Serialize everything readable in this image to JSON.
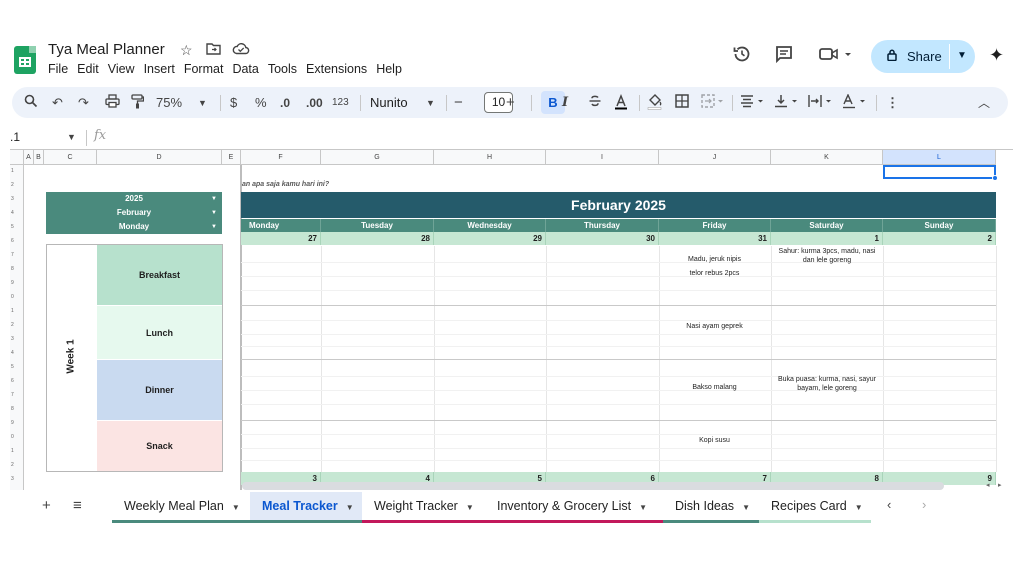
{
  "doc": {
    "title": "Tya Meal Planner",
    "menu": [
      "File",
      "Edit",
      "View",
      "Insert",
      "Format",
      "Data",
      "Tools",
      "Extensions",
      "Help"
    ]
  },
  "share": {
    "label": "Share"
  },
  "toolbar": {
    "zoom": "75%",
    "currency": "$",
    "percent": "%",
    "dec_decrease": ".0",
    "dec_increase": ".00",
    "number_format": "123",
    "font": "Nunito",
    "font_size": "10",
    "minus": "−",
    "plus": "+",
    "bold": "B",
    "italic": "I"
  },
  "formula_bar": {
    "name_box": ".1",
    "fx": "fx"
  },
  "columns": [
    "A",
    "B",
    "C",
    "D",
    "E",
    "F",
    "G",
    "H",
    "I",
    "J",
    "K",
    "L"
  ],
  "selected_column": "L",
  "selectors": [
    "2025",
    "February",
    "Monday"
  ],
  "week_label": "Week 1",
  "meals": [
    "Breakfast",
    "Lunch",
    "Dinner",
    "Snack"
  ],
  "meal_colors": [
    "#b7e1cd",
    "#e6f9ee",
    "#c9daf0",
    "#fbe4e3"
  ],
  "hint": "an apa saja kamu hari ini?",
  "calendar": {
    "month": "February 2025",
    "days": [
      "Monday",
      "Tuesday",
      "Wednesday",
      "Thursday",
      "Friday",
      "Saturday",
      "Sunday"
    ],
    "dates": [
      "27",
      "28",
      "29",
      "30",
      "31",
      "1",
      "2"
    ],
    "next_dates": [
      "3",
      "4",
      "5",
      "6",
      "7",
      "8",
      "9"
    ],
    "friday": {
      "breakfast_1": "Madu, jeruk nipis",
      "breakfast_2": "telor rebus 2pcs",
      "lunch": "Nasi ayam geprek",
      "dinner": "Bakso malang",
      "snack": "Kopi susu"
    },
    "saturday": {
      "breakfast": "Sahur: kurma 3pcs, madu, nasi dan lele goreng",
      "dinner": "Buka puasa: kurma, nasi, sayur bayam, lele goreng"
    }
  },
  "sheet_tabs": [
    {
      "label": "Weekly Meal Plan",
      "color": "#4a8a7d"
    },
    {
      "label": "Meal Tracker",
      "color": "#4a8a7d"
    },
    {
      "label": "Weight Tracker",
      "color": "#c2185b"
    },
    {
      "label": "Inventory & Grocery List",
      "color": "#c2185b"
    },
    {
      "label": "Dish Ideas",
      "color": "#4a8a7d"
    },
    {
      "label": "Recipes Card",
      "color": "#b7e1cd"
    }
  ],
  "active_tab": "Meal Tracker",
  "rownums": [
    "1",
    "2",
    "3",
    "4",
    "5",
    "6",
    "7",
    "8",
    "9",
    "0",
    "1",
    "2",
    "3",
    "4",
    "5",
    "6",
    "7",
    "8",
    "9",
    "0",
    "1",
    "2",
    "3"
  ]
}
